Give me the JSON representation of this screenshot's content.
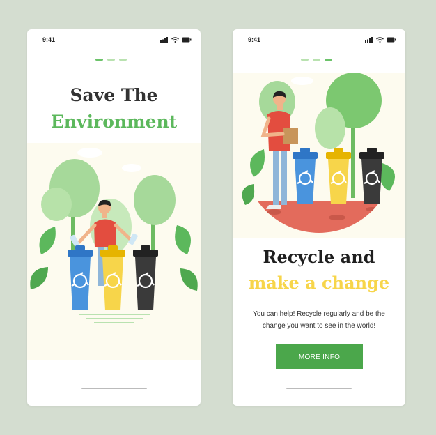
{
  "screen1": {
    "status_time": "9:41",
    "title_line1": "Save The",
    "title_line2": "Environment",
    "page_indicator": {
      "count": 3,
      "active": 0
    }
  },
  "screen2": {
    "status_time": "9:41",
    "title_line1": "Recycle and",
    "title_line2": "make a change",
    "description_line1": "You can help! Recycle regularly and be the",
    "description_line2": "change you want to see in the world!",
    "button_label": "MORE INFO",
    "page_indicator": {
      "count": 3,
      "active": 2
    }
  },
  "colors": {
    "brand_green": "#5cb85c",
    "title_dark": "#333333",
    "accent_yellow": "#f7d54a",
    "button_green": "#4ba74b",
    "illustration_bg": "#fdfbef",
    "page_bg": "#d4ddd0"
  },
  "icons": [
    "signal-icon",
    "wifi-icon",
    "battery-icon",
    "recycle-icon"
  ]
}
